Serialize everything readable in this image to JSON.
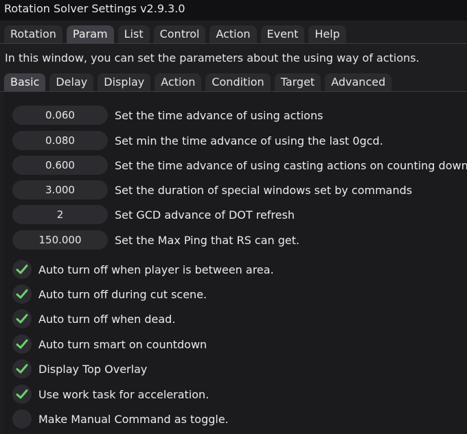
{
  "window": {
    "title": "Rotation Solver Settings v2.9.3.0"
  },
  "tabs": [
    {
      "label": "Rotation"
    },
    {
      "label": "Param"
    },
    {
      "label": "List"
    },
    {
      "label": "Control"
    },
    {
      "label": "Action"
    },
    {
      "label": "Event"
    },
    {
      "label": "Help"
    }
  ],
  "active_tab": "Param",
  "description": "In this window, you can set the parameters about the using way of actions.",
  "subtabs": [
    {
      "label": "Basic"
    },
    {
      "label": "Delay"
    },
    {
      "label": "Display"
    },
    {
      "label": "Action"
    },
    {
      "label": "Condition"
    },
    {
      "label": "Target"
    },
    {
      "label": "Advanced"
    }
  ],
  "active_subtab": "Basic",
  "params": [
    {
      "value": "0.060",
      "label": "Set the time advance of using actions"
    },
    {
      "value": "0.080",
      "label": "Set min the time advance of using the last 0gcd."
    },
    {
      "value": "0.600",
      "label": "Set the time advance of using casting actions on counting down."
    },
    {
      "value": "3.000",
      "label": "Set the duration of special windows set by commands"
    },
    {
      "value": "2",
      "label": "Set GCD advance of DOT refresh"
    },
    {
      "value": "150.000",
      "label": "Set the Max Ping that RS can get."
    }
  ],
  "checkboxes": [
    {
      "label": "Auto turn off when player is between area.",
      "checked": true
    },
    {
      "label": "Auto turn off during cut scene.",
      "checked": true
    },
    {
      "label": "Auto turn off when dead.",
      "checked": true
    },
    {
      "label": "Auto turn smart on countdown",
      "checked": true
    },
    {
      "label": "Display Top Overlay",
      "checked": true
    },
    {
      "label": "Use work task for acceleration.",
      "checked": true
    },
    {
      "label": "Make Manual Command as toggle.",
      "checked": false
    }
  ],
  "colors": {
    "check": "#6fcf6f",
    "field": "#2c2c30",
    "active_tab": "#3f3f45"
  }
}
